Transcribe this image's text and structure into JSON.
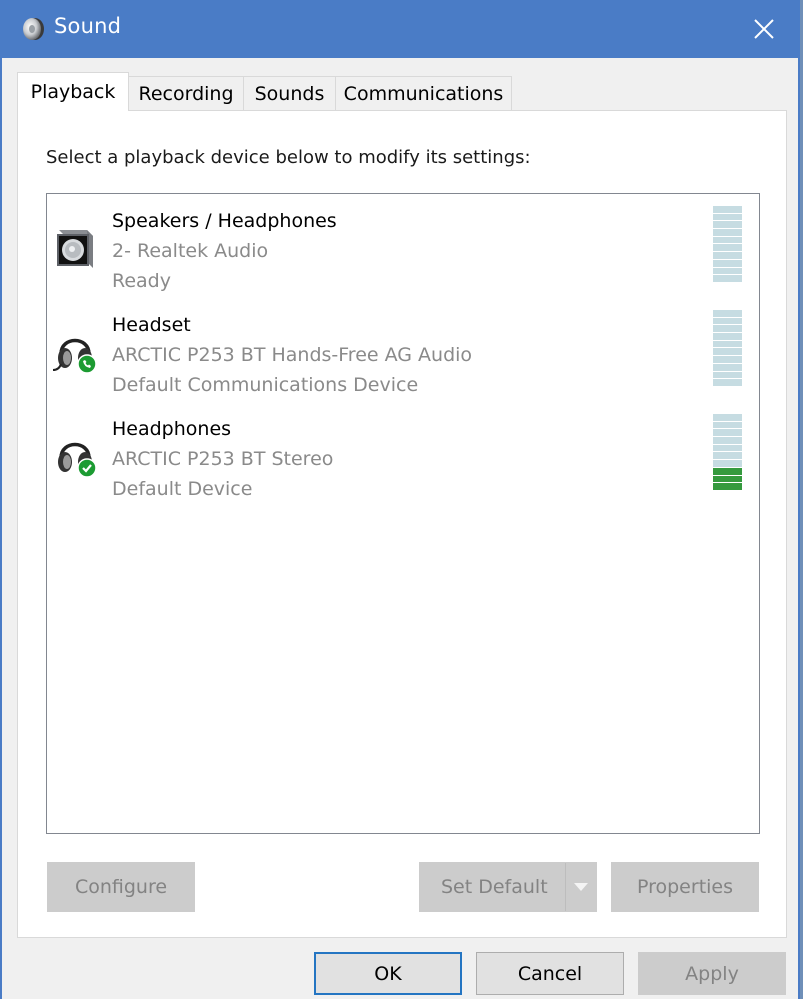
{
  "window": {
    "title": "Sound",
    "close_icon": "close-icon",
    "app_icon": "speaker-icon",
    "title_bar_color": "#4a7cc6"
  },
  "tabs": [
    {
      "label": "Playback",
      "active": true
    },
    {
      "label": "Recording",
      "active": false
    },
    {
      "label": "Sounds",
      "active": false
    },
    {
      "label": "Communications",
      "active": false
    }
  ],
  "playback": {
    "instruction": "Select a playback device below to modify its settings:",
    "devices": [
      {
        "name": "Speakers / Headphones",
        "driver": "2- Realtek Audio",
        "status": "Ready",
        "icon": "speaker-box-icon",
        "badge": null,
        "level_fraction": 0.0
      },
      {
        "name": "Headset",
        "driver": "ARCTIC P253 BT Hands-Free AG Audio",
        "status": "Default Communications Device",
        "icon": "headset-icon",
        "badge": "phone-badge-icon",
        "level_fraction": 0.0
      },
      {
        "name": "Headphones",
        "driver": "ARCTIC P253 BT Stereo",
        "status": "Default Device",
        "icon": "headphones-icon",
        "badge": "check-badge-icon",
        "level_fraction": 0.3
      }
    ],
    "meter_segments": 10,
    "meter_colors": {
      "off": "#c6dce2",
      "on": "#359a3e"
    },
    "buttons": {
      "configure": "Configure",
      "set_default": "Set Default",
      "properties": "Properties"
    }
  },
  "footer": {
    "ok": "OK",
    "cancel": "Cancel",
    "apply": "Apply"
  }
}
